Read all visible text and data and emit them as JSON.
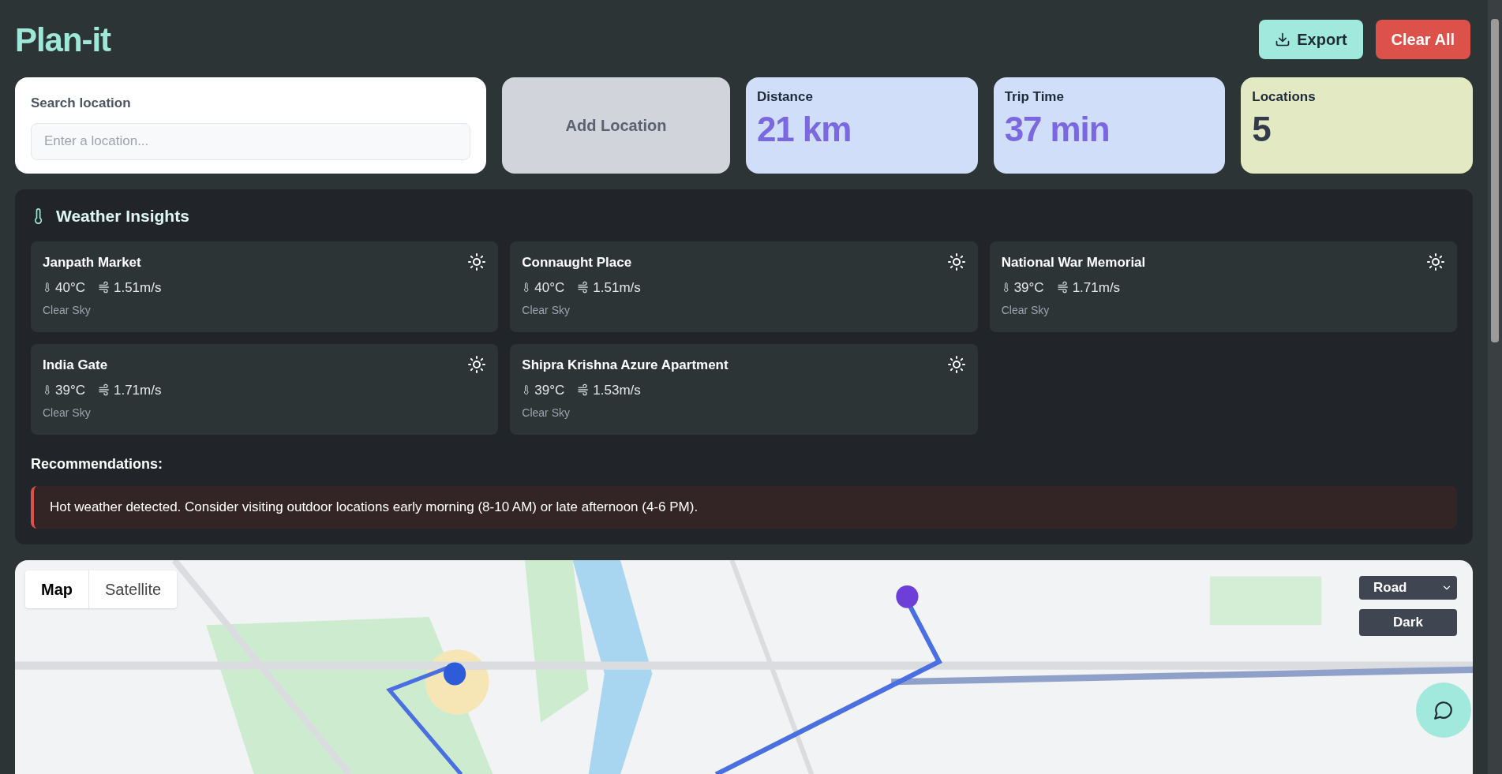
{
  "app": {
    "title": "Plan-it"
  },
  "header_buttons": [
    {
      "kind": "export",
      "label": "Export"
    },
    {
      "kind": "clear",
      "label": "Clear All"
    }
  ],
  "search": {
    "label": "Search location",
    "placeholder": "Enter a location..."
  },
  "add_button": {
    "label": "Add Location"
  },
  "stats": [
    {
      "label": "Distance",
      "value": "21 km",
      "color": "#d0defa"
    },
    {
      "label": "Trip Time",
      "value": "37 min",
      "color": "#d0defa"
    },
    {
      "label": "Locations",
      "value": "5",
      "color": "#e2e9c3"
    }
  ],
  "weather": {
    "title": "Weather Insights",
    "cards": [
      {
        "place": "Janpath Market",
        "temperature": "40°C",
        "wind": "1.51m/s",
        "condition": "Clear Sky"
      },
      {
        "place": "Connaught Place",
        "temperature": "40°C",
        "wind": "1.51m/s",
        "condition": "Clear Sky"
      },
      {
        "place": "National War Memorial",
        "temperature": "39°C",
        "wind": "1.71m/s",
        "condition": "Clear Sky"
      },
      {
        "place": "India Gate",
        "temperature": "39°C",
        "wind": "1.71m/s",
        "condition": "Clear Sky"
      },
      {
        "place": "Shipra Krishna Azure Apartment",
        "temperature": "39°C",
        "wind": "1.53m/s",
        "condition": "Clear Sky"
      }
    ],
    "recommendations_title": "Recommendations:",
    "recommendations": [
      "Hot weather detected. Consider visiting outdoor locations early morning (8-10 AM) or late afternoon (4-6 PM)."
    ]
  },
  "map": {
    "kind": "picture",
    "view_tabs": [
      {
        "label": "Map",
        "selected": true
      },
      {
        "label": "Satellite",
        "selected": false
      }
    ],
    "style_select": {
      "value": "Road"
    },
    "theme_button": {
      "label": "Dark"
    }
  }
}
